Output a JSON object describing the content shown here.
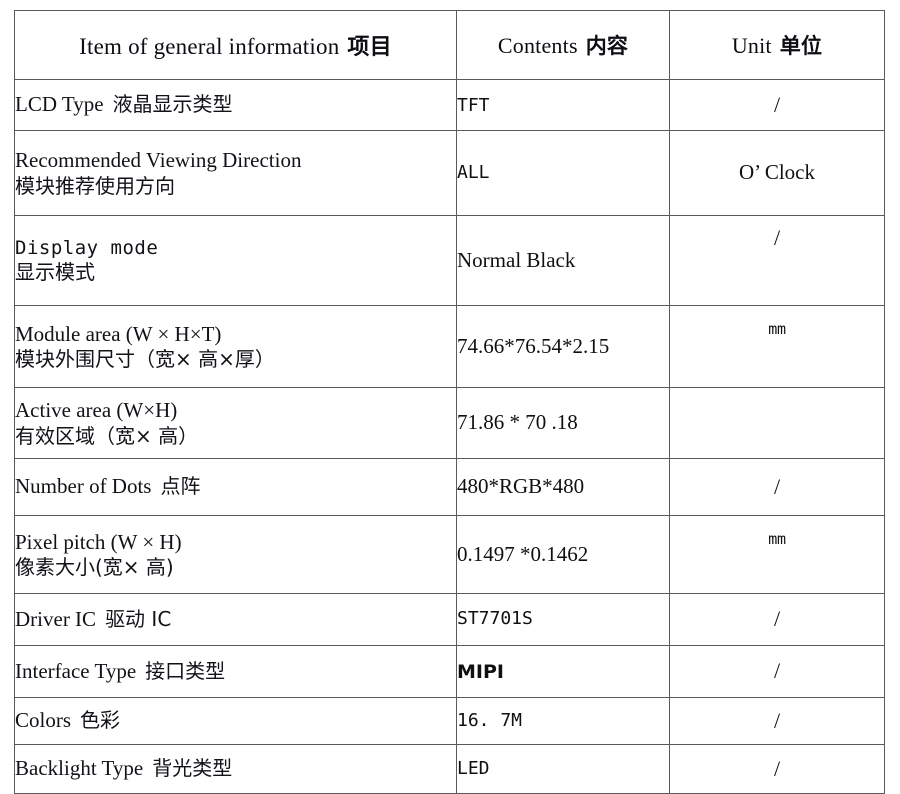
{
  "table": {
    "headers": {
      "item_en": "Item of general information",
      "item_cn": "项目",
      "contents_en": "Contents",
      "contents_cn": "内容",
      "unit_en": "Unit",
      "unit_cn": "单位"
    },
    "rows": [
      {
        "item_en": "LCD Type",
        "item_cn": "液晶显示类型",
        "content": "TFT",
        "unit": "/"
      },
      {
        "item_en": "Recommended Viewing Direction",
        "item_cn": "模块推荐使用方向",
        "content": "ALL",
        "unit": "O’ Clock"
      },
      {
        "item_en": "Display mode",
        "item_cn": "显示模式",
        "content": "Normal Black",
        "unit": "/"
      },
      {
        "item_en": "Module area (W × H×T)",
        "item_cn": "模块外围尺寸（宽×  高×厚）",
        "content": "74.66*76.54*2.15",
        "unit": "mm"
      },
      {
        "item_en": "Active area (W×H)",
        "item_cn": "有效区域（宽×  高）",
        "content": "71.86 * 70 .18",
        "unit": ""
      },
      {
        "item_en": "Number of Dots",
        "item_cn": "点阵",
        "content": "480*RGB*480",
        "unit": "/"
      },
      {
        "item_en": "Pixel pitch (W × H)",
        "item_cn": "像素大小(宽×  高)",
        "content": "0.1497  *0.1462",
        "unit": "mm"
      },
      {
        "item_en": "Driver  IC",
        "item_cn": "驱动  IC",
        "content": "ST7701S",
        "unit": "/"
      },
      {
        "item_en": "Interface Type",
        "item_cn": "接口类型",
        "content": "MIPI",
        "unit": "/"
      },
      {
        "item_en": "Colors",
        "item_cn": "色彩",
        "content": "16. 7M",
        "unit": "/"
      },
      {
        "item_en": "Backlight Type",
        "item_cn": "背光类型",
        "content": "LED",
        "unit": "/"
      }
    ]
  }
}
